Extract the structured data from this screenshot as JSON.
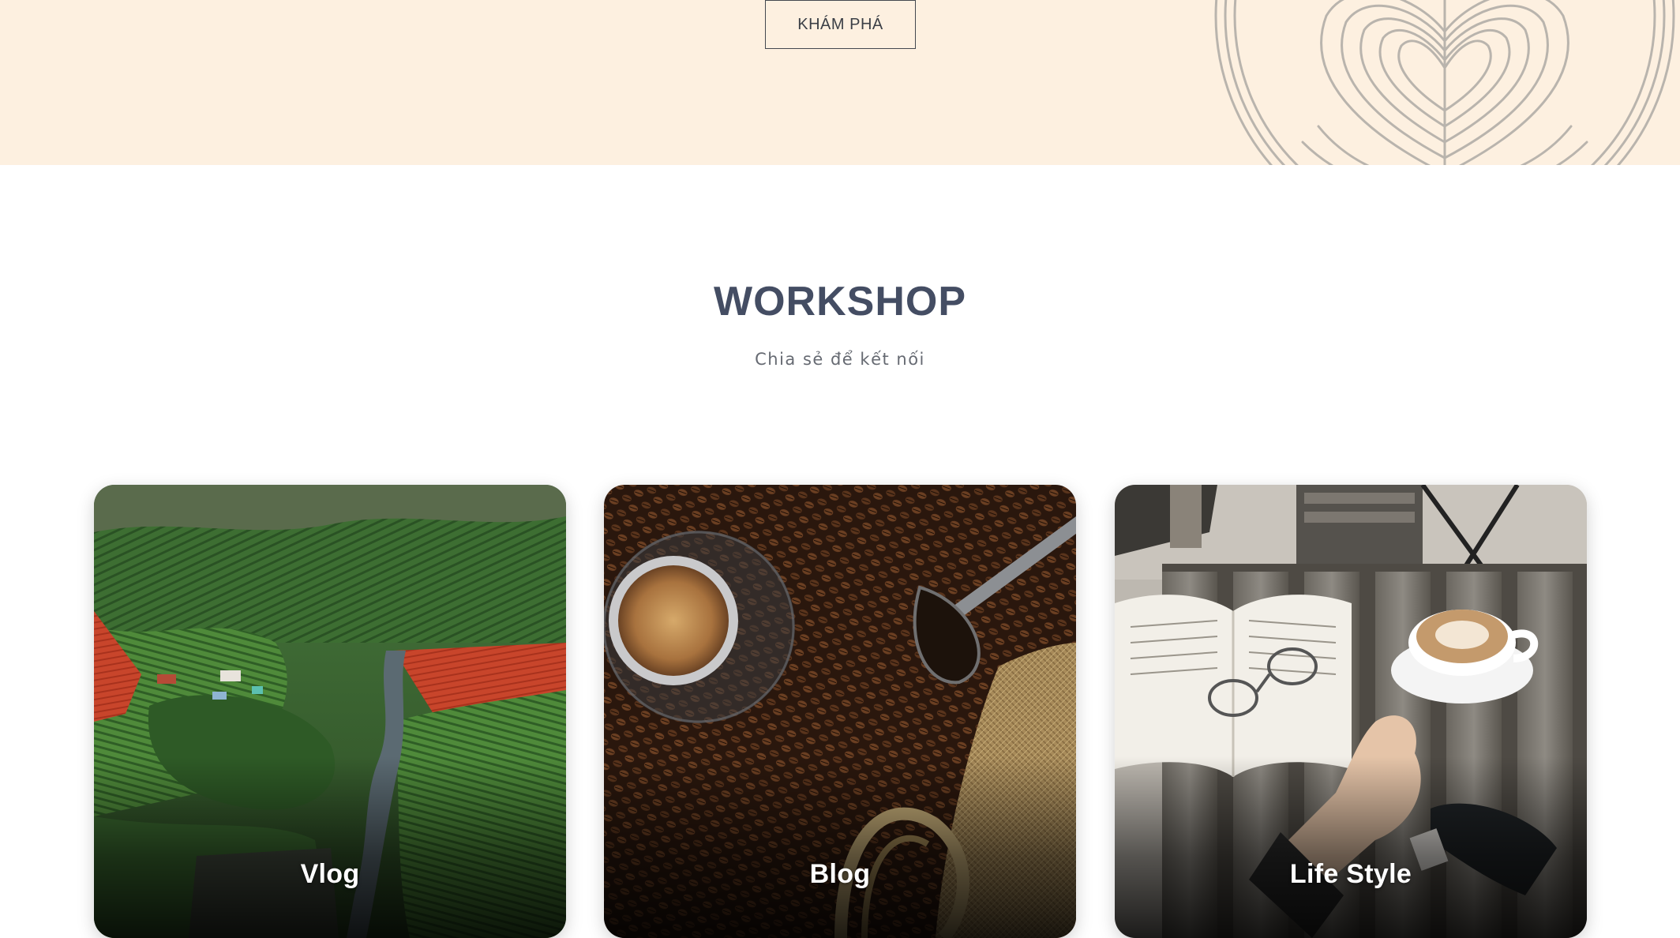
{
  "hero": {
    "explore_button_label": "KHÁM PHÁ",
    "background_color": "#fdf0e0",
    "art_icon": "latte-art-illustration"
  },
  "workshop": {
    "title": "WORKSHOP",
    "subtitle": "Chia sẻ để kết nối",
    "title_color": "#444d63",
    "cards": [
      {
        "label": "Vlog",
        "image": "aerial-coffee-farm-photo"
      },
      {
        "label": "Blog",
        "image": "coffee-beans-and-espresso-photo"
      },
      {
        "label": "Life Style",
        "image": "cafe-table-book-cappuccino-photo"
      }
    ]
  }
}
